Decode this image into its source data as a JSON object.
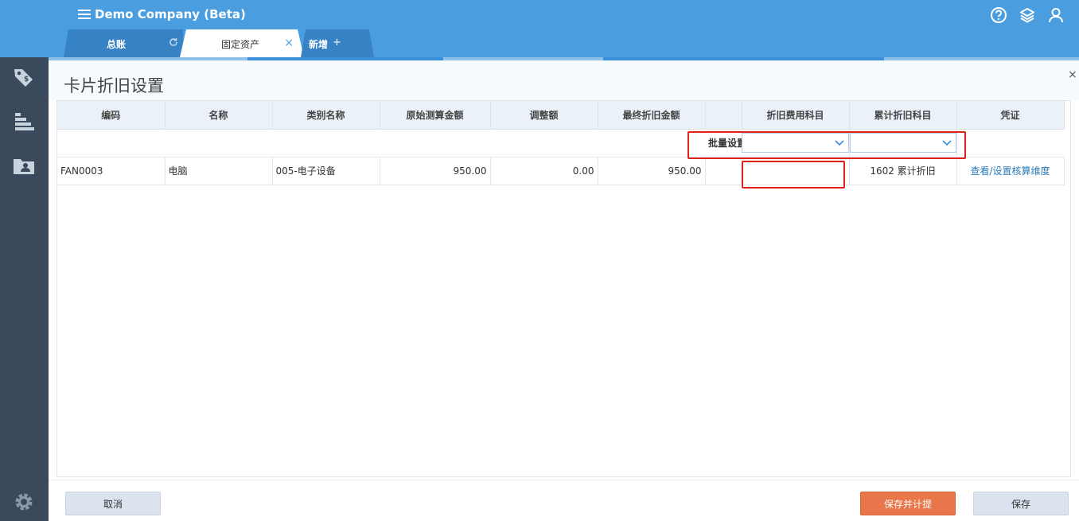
{
  "app": {
    "company": "Demo Company (Beta)"
  },
  "tabs": [
    {
      "label": "总账"
    },
    {
      "label": "固定资产",
      "close": "×"
    },
    {
      "label": "新增",
      "plus": "+"
    }
  ],
  "page": {
    "title": "卡片折旧设置",
    "close": "×"
  },
  "table": {
    "headers": [
      "编码",
      "名称",
      "类别名称",
      "原始测算金额",
      "调整额",
      "最终折旧金额",
      "",
      "折旧费用科目",
      "累计折旧科目",
      "凭证"
    ],
    "batch_label": "批量设置",
    "rows": [
      {
        "code": "FAN0003",
        "name": "电脑",
        "category": "005-电子设备",
        "original_amount": "950.00",
        "adjustment": "0.00",
        "final_amount": "950.00",
        "expense_account": "",
        "accum_account": "1602 累计折旧",
        "voucher_link": "查看/设置核算维度"
      }
    ]
  },
  "footer": {
    "cancel": "取消",
    "save_and_calc": "保存并计提",
    "save": "保存"
  },
  "colors": {
    "header_blue": "#4a9ee0",
    "sidebar": "#3a4a5c",
    "primary_button": "#e8764a",
    "highlight_red": "#e0201a",
    "link": "#2a7ab8"
  },
  "icons": [
    "menu-icon",
    "help-icon",
    "layers-icon",
    "user-icon",
    "refresh-icon",
    "tag-icon",
    "chart-icon",
    "folder-icon",
    "gear-icon",
    "chevron-down-icon"
  ]
}
